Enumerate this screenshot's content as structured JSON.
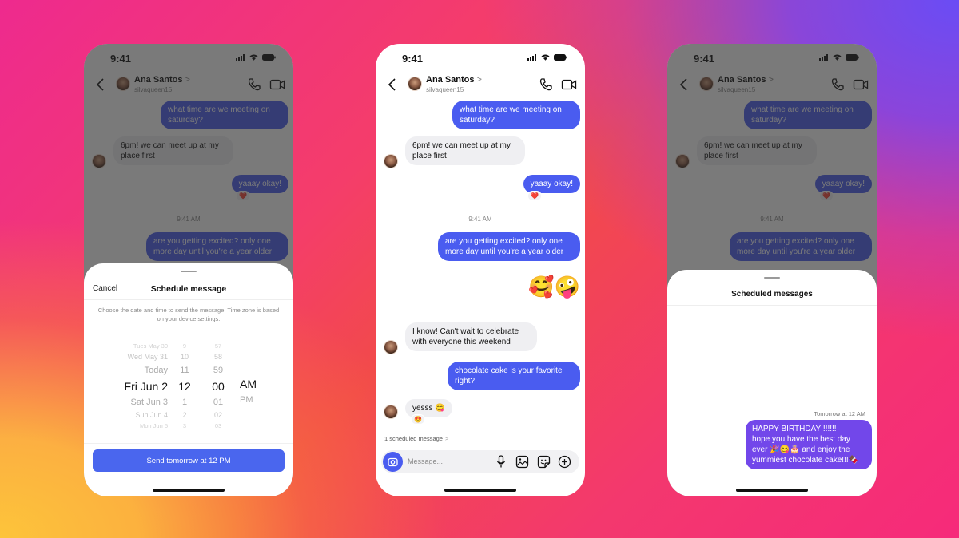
{
  "colors": {
    "outgoing_bubble": "#4a5cf0",
    "incoming_bubble": "#efeff2",
    "send_button": "#4a66ee",
    "scheduled_bubble": "#7247ea"
  },
  "status_bar": {
    "time": "9:41"
  },
  "chat_header": {
    "contact_name": "Ana Santos",
    "name_chevron": ">",
    "handle": "silvaqueen15",
    "icons": [
      "back-chevron-icon",
      "phone-icon",
      "video-camera-icon"
    ]
  },
  "messages": [
    {
      "direction": "out",
      "text": "what time are we meeting on saturday?"
    },
    {
      "direction": "in",
      "text": "6pm! we can meet up at my place first"
    },
    {
      "direction": "out",
      "text": "yaaay okay!",
      "reaction": "❤️"
    },
    {
      "type": "timestamp",
      "text": "9:41 AM"
    },
    {
      "direction": "out",
      "text": "are you getting excited? only one more day until you're a year older"
    },
    {
      "direction": "out",
      "type": "sticker",
      "text": "🥰🤪"
    },
    {
      "direction": "in",
      "text": "I know! Can't wait to celebrate with everyone this weekend"
    },
    {
      "direction": "out",
      "text": "chocolate cake is your favorite right?"
    },
    {
      "direction": "in",
      "text": "yesss 😋",
      "reaction": "😍"
    }
  ],
  "schedule_sheet": {
    "cancel_label": "Cancel",
    "title": "Schedule message",
    "description": "Choose the date and time to send the message. Time zone is based on your device settings.",
    "picker": {
      "days": [
        "Tues May 30",
        "Wed May 31",
        "Today",
        "Fri Jun 2",
        "Sat Jun 3",
        "Sun Jun 4",
        "Mon Jun 5"
      ],
      "hours": [
        "9",
        "10",
        "11",
        "12",
        "1",
        "2",
        "3"
      ],
      "minutes": [
        "57",
        "58",
        "59",
        "00",
        "01",
        "02",
        "03"
      ],
      "periods": [
        "AM",
        "PM"
      ],
      "selected": {
        "day": "Fri Jun 2",
        "hour": "12",
        "minute": "00",
        "period": "AM"
      }
    },
    "send_button_label": "Send tomorrow at 12 PM"
  },
  "composer": {
    "scheduled_link": "1 scheduled message",
    "scheduled_chevron": ">",
    "placeholder": "Message...",
    "icons": [
      "camera-icon",
      "microphone-icon",
      "gallery-icon",
      "sticker-icon",
      "add-icon"
    ]
  },
  "scheduled_sheet": {
    "title": "Scheduled messages",
    "items": [
      {
        "when": "Tomorrow at 12 AM",
        "lines": [
          "HAPPY BIRTHDAY!!!!!!!",
          "hope you have the best day",
          "ever 🎉😋🎂 and enjoy the",
          "yummiest chocolate cake!!!🍫"
        ]
      }
    ]
  }
}
